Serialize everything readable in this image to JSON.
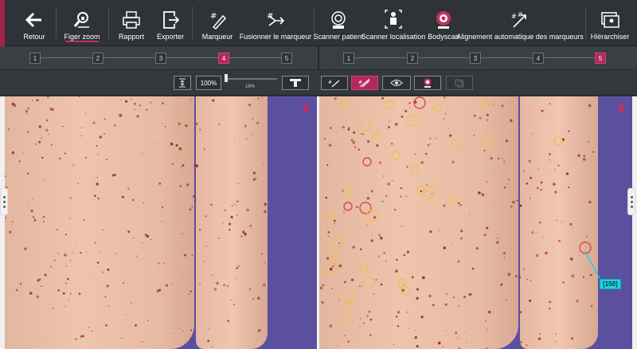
{
  "toolbar": {
    "items": [
      {
        "label": "Retour",
        "icon": "arrow-left-icon"
      },
      {
        "label": "Figer zoom",
        "icon": "freeze-zoom-icon"
      },
      {
        "label": "Rapport",
        "icon": "printer-icon"
      },
      {
        "label": "Exporter",
        "icon": "export-icon"
      },
      {
        "label": "Marqueur",
        "icon": "marker-icon"
      },
      {
        "label": "Fusionner le marqueur",
        "icon": "merge-marker-icon"
      },
      {
        "label": "Scanner patient",
        "icon": "scan-patient-icon"
      },
      {
        "label": "Scanner localisation",
        "icon": "scan-location-icon"
      },
      {
        "label": "Bodyscan",
        "icon": "bodyscan-icon"
      },
      {
        "label": "Alignement automatique des marqueurs",
        "icon": "auto-align-icon"
      },
      {
        "label": "Hiérarchiser",
        "icon": "hierarchy-icon"
      }
    ]
  },
  "stepper_left": {
    "steps": [
      "1",
      "2",
      "3",
      "4",
      "5"
    ],
    "active": "4"
  },
  "stepper_right": {
    "steps": [
      "1",
      "2",
      "3",
      "4",
      "5"
    ],
    "active": "5"
  },
  "tools": {
    "zoom_value": "100%",
    "slider_percent": "16%",
    "slider_fraction": 0.16
  },
  "measurement": {
    "value": "[150]"
  },
  "colors": {
    "accent": "#b4295a",
    "toolbar_bg": "#2f3337",
    "marker_yellow": "#f0c04a",
    "marker_red": "#d23a3a",
    "measure_cyan": "#1fd3e0",
    "background_blue": "#5b4fa0"
  }
}
